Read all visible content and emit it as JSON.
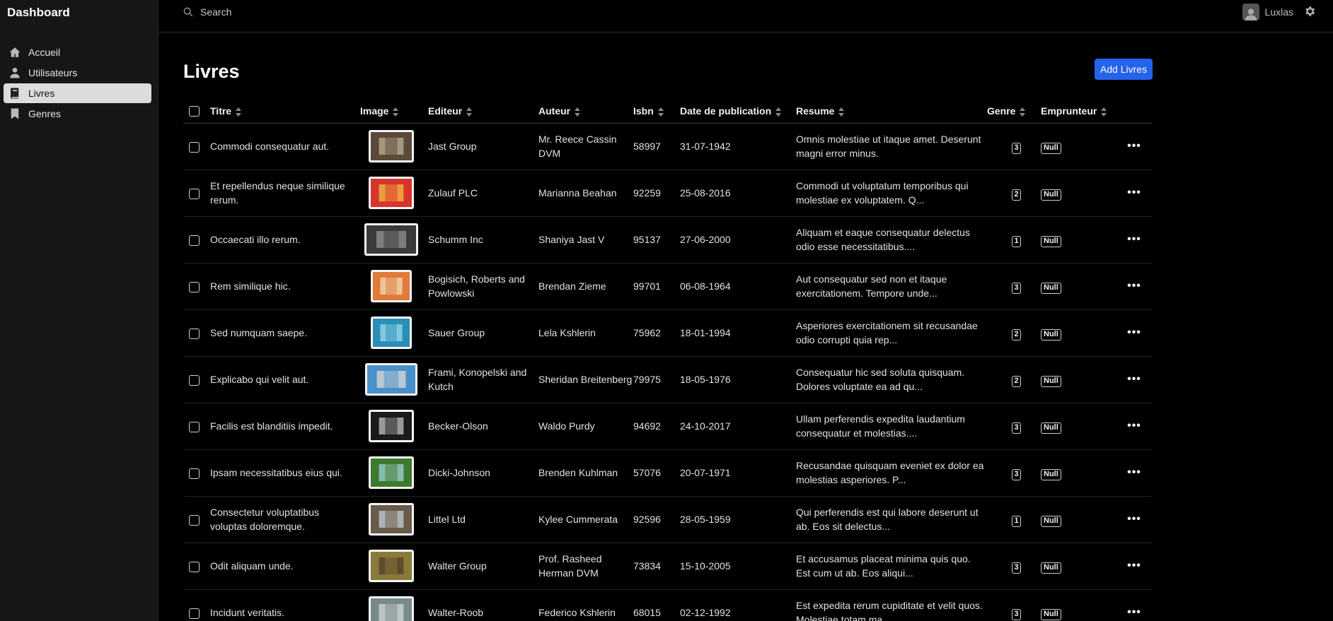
{
  "brand": "Dashboard",
  "nav": [
    {
      "label": "Accueil",
      "icon": "home-icon"
    },
    {
      "label": "Utilisateurs",
      "icon": "user-icon"
    },
    {
      "label": "Livres",
      "icon": "book-icon",
      "active": true
    },
    {
      "label": "Genres",
      "icon": "bookmark-icon"
    }
  ],
  "search": {
    "placeholder": "Search"
  },
  "user": {
    "name": "Luxlas"
  },
  "page": {
    "title": "Livres",
    "add_label": "Add Livres"
  },
  "columns": {
    "titre": "Titre",
    "image": "Image",
    "editeur": "Editeur",
    "auteur": "Auteur",
    "isbn": "Isbn",
    "date": "Date de publication",
    "resume": "Resume",
    "genre": "Genre",
    "emprunteur": "Emprunteur"
  },
  "rows": [
    {
      "titre": "Commodi consequatur aut.",
      "editeur": "Jast Group",
      "auteur": "Mr. Reece Cassin DVM",
      "isbn": "58997",
      "date": "31-07-1942",
      "resume": "Omnis molestiae ut itaque amet. Deserunt magni error minus.",
      "genre": "3",
      "emprunteur": "Null",
      "img": [
        "#5a4a3a",
        "#c8b89a"
      ]
    },
    {
      "titre": "Et repellendus neque similique rerum.",
      "editeur": "Zulauf PLC",
      "auteur": "Marianna Beahan",
      "isbn": "92259",
      "date": "25-08-2016",
      "resume": "Commodi ut voluptatum temporibus qui molestiae ex voluptatem. Q...",
      "genre": "2",
      "emprunteur": "Null",
      "img": [
        "#d9342b",
        "#f2c94c"
      ]
    },
    {
      "titre": "Occaecati illo rerum.",
      "editeur": "Schumm Inc",
      "auteur": "Shaniya Jast V",
      "isbn": "95137",
      "date": "27-06-2000",
      "resume": "Aliquam et eaque consequatur delectus odio esse necessitatibus....",
      "genre": "1",
      "emprunteur": "Null",
      "img": [
        "#3a3a3a",
        "#9a9a9a"
      ]
    },
    {
      "titre": "Rem similique hic.",
      "editeur": "Bogisich, Roberts and Powlowski",
      "auteur": "Brendan Zieme",
      "isbn": "99701",
      "date": "06-08-1964",
      "resume": "Aut consequatur sed non et itaque exercitationem. Tempore unde...",
      "genre": "3",
      "emprunteur": "Null",
      "img": [
        "#e07b39",
        "#f4e3c1"
      ]
    },
    {
      "titre": "Sed numquam saepe.",
      "editeur": "Sauer Group",
      "auteur": "Lela Kshlerin",
      "isbn": "75962",
      "date": "18-01-1994",
      "resume": "Asperiores exercitationem sit recusandae odio corrupti quia rep...",
      "genre": "2",
      "emprunteur": "Null",
      "img": [
        "#2a8fb8",
        "#a8e0f0"
      ]
    },
    {
      "titre": "Explicabo qui velit aut.",
      "editeur": "Frami, Konopelski and Kutch",
      "auteur": "Sheridan Breitenberg",
      "isbn": "79975",
      "date": "18-05-1976",
      "resume": "Consequatur hic sed soluta quisquam. Dolores voluptate ea ad qu...",
      "genre": "2",
      "emprunteur": "Null",
      "img": [
        "#4a90c8",
        "#e8e0d8"
      ]
    },
    {
      "titre": "Facilis est blanditiis impedit.",
      "editeur": "Becker-Olson",
      "auteur": "Waldo Purdy",
      "isbn": "94692",
      "date": "24-10-2017",
      "resume": "Ullam perferendis expedita laudantium consequatur et molestias....",
      "genre": "3",
      "emprunteur": "Null",
      "img": [
        "#1a1a1a",
        "#d0d0d0"
      ]
    },
    {
      "titre": "Ipsam necessitatibus eius qui.",
      "editeur": "Dicki-Johnson",
      "auteur": "Brenden Kuhlman",
      "isbn": "57076",
      "date": "20-07-1971",
      "resume": "Recusandae quisquam eveniet ex dolor ea molestias asperiores. P...",
      "genre": "3",
      "emprunteur": "Null",
      "img": [
        "#3e7a2e",
        "#a8d8e8"
      ]
    },
    {
      "titre": "Consectetur voluptatibus voluptas doloremque.",
      "editeur": "Littel Ltd",
      "auteur": "Kylee Cummerata",
      "isbn": "92596",
      "date": "28-05-1959",
      "resume": "Qui perferendis est qui labore deserunt ut ab. Eos sit delectus...",
      "genre": "1",
      "emprunteur": "Null",
      "img": [
        "#6a5a4a",
        "#c8d8e0"
      ]
    },
    {
      "titre": "Odit aliquam unde.",
      "editeur": "Walter Group",
      "auteur": "Prof. Rasheed Herman DVM",
      "isbn": "73834",
      "date": "15-10-2005",
      "resume": "Et accusamus placeat minima quis quo. Est cum ut ab. Eos aliqui...",
      "genre": "3",
      "emprunteur": "Null",
      "img": [
        "#8a7a3a",
        "#4a3a2a"
      ]
    },
    {
      "titre": "Incidunt veritatis.",
      "editeur": "Walter-Roob",
      "auteur": "Federico Kshlerin",
      "isbn": "68015",
      "date": "02-12-1992",
      "resume": "Est expedita rerum cupiditate et velit quos. Molestiae totam ma...",
      "genre": "3",
      "emprunteur": "Null",
      "img": [
        "#7a8a8a",
        "#d8e0e0"
      ]
    }
  ]
}
